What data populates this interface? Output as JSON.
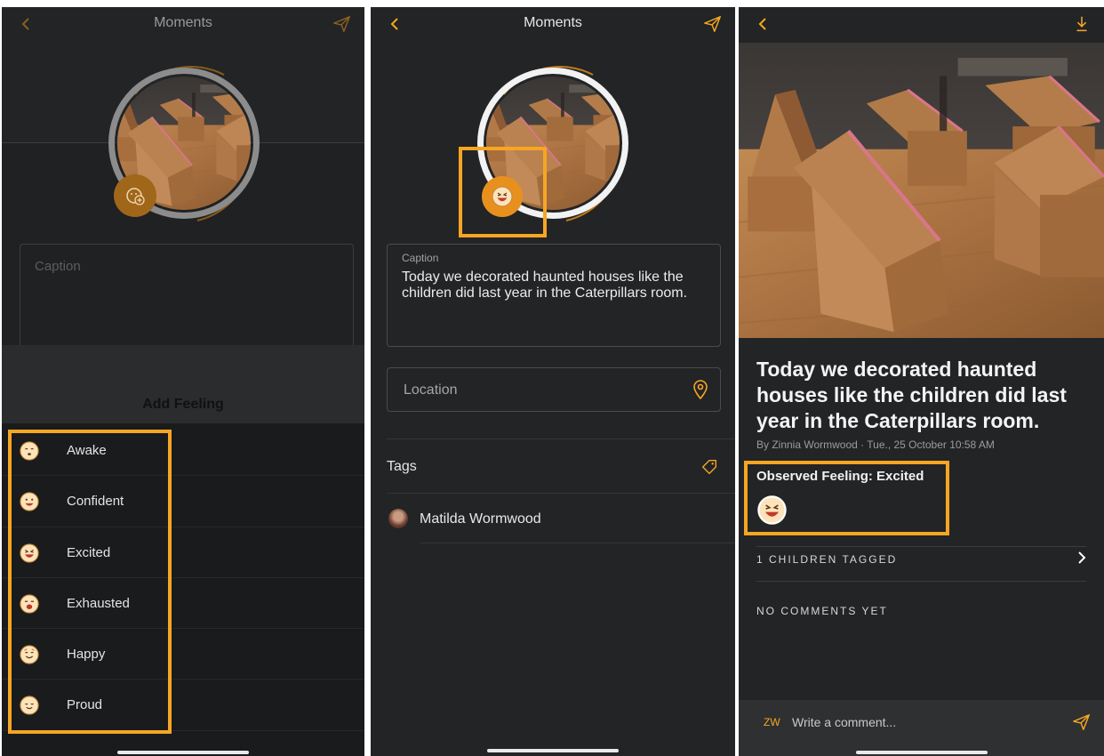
{
  "colors": {
    "accent": "#f6a623",
    "background": "#222426",
    "highlight": "#f6a623"
  },
  "screen1": {
    "title": "Moments",
    "caption_placeholder": "Caption",
    "sheet_title": "Add Feeling",
    "feelings": [
      {
        "label": "Awake",
        "icon": "awake-emoji-icon"
      },
      {
        "label": "Confident",
        "icon": "confident-emoji-icon"
      },
      {
        "label": "Excited",
        "icon": "excited-emoji-icon"
      },
      {
        "label": "Exhausted",
        "icon": "exhausted-emoji-icon"
      },
      {
        "label": "Happy",
        "icon": "happy-emoji-icon"
      },
      {
        "label": "Proud",
        "icon": "proud-emoji-icon"
      }
    ]
  },
  "screen2": {
    "title": "Moments",
    "caption_label": "Caption",
    "caption_text": "Today we decorated haunted houses like the children did last year in the Caterpillars room.",
    "location_placeholder": "Location",
    "tags_label": "Tags",
    "tagged_child": "Matilda Wormwood"
  },
  "screen3": {
    "post_title": "Today we decorated haunted houses like the children did last year in the Caterpillars room.",
    "byline": "By Zinnia Wormwood · Tue., 25 October 10:58 AM",
    "observed_feeling": "Observed Feeling: Excited",
    "children_tagged": "1 CHILDREN TAGGED",
    "no_comments": "NO COMMENTS YET",
    "commenter_initials": "ZW",
    "comment_placeholder": "Write a comment..."
  }
}
